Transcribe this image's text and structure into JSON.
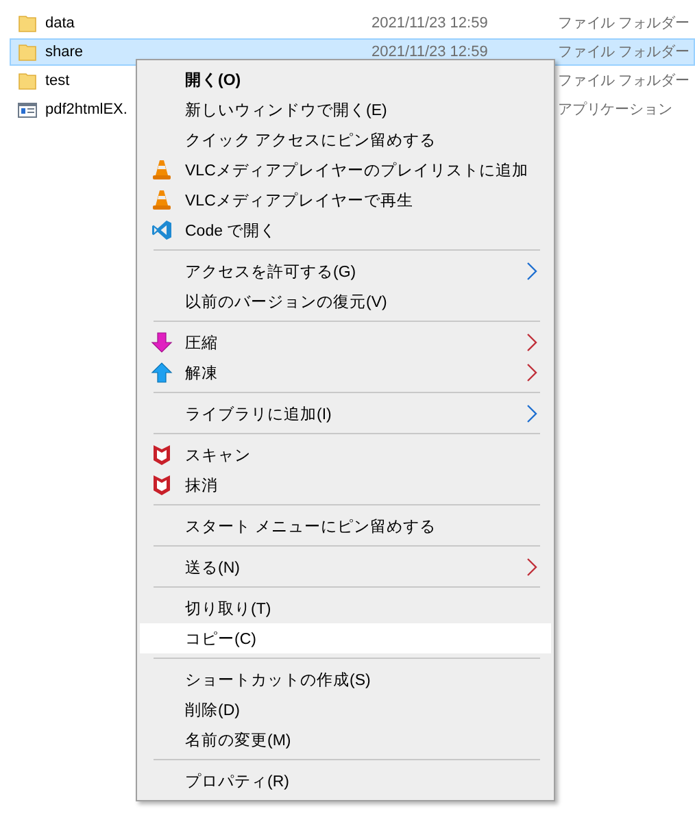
{
  "files": [
    {
      "name": "data",
      "date": "2021/11/23 12:59",
      "type": "ファイル フォルダー",
      "kind": "folder",
      "selected": false
    },
    {
      "name": "share",
      "date": "2021/11/23 12:59",
      "type": "ファイル フォルダー",
      "kind": "folder",
      "selected": true
    },
    {
      "name": "test",
      "type": "ファイル フォルダー",
      "kind": "folder",
      "selected": false
    },
    {
      "name": "pdf2htmlEX.",
      "type": "アプリケーション",
      "kind": "app",
      "selected": false
    }
  ],
  "context_menu": {
    "sections": [
      [
        {
          "label": "開く(O)",
          "bold": true,
          "selected": false
        },
        {
          "label": "新しいウィンドウで開く(E)",
          "bold": false,
          "selected": false
        },
        {
          "label": "クイック アクセスにピン留めする",
          "bold": false,
          "selected": false
        },
        {
          "label": "VLCメディアプレイヤーのプレイリストに追加",
          "bold": false,
          "selected": false
        },
        {
          "label": "VLCメディアプレイヤーで再生",
          "bold": false,
          "selected": false
        },
        {
          "label": "Code で開く",
          "bold": false,
          "selected": false
        }
      ],
      [
        {
          "label": "アクセスを許可する(G)",
          "bold": false,
          "selected": false,
          "submenu": true,
          "color": "#1e6fd0"
        },
        {
          "label": "以前のバージョンの復元(V)",
          "bold": false,
          "selected": false
        }
      ],
      [
        {
          "label": "圧縮",
          "bold": false,
          "selected": false,
          "submenu": true,
          "color": "#c0303a"
        },
        {
          "label": "解凍",
          "bold": false,
          "selected": false,
          "submenu": true,
          "color": "#c0303a"
        }
      ],
      [
        {
          "label": "ライブラリに追加(I)",
          "bold": false,
          "selected": false,
          "submenu": true,
          "color": "#1e6fd0"
        }
      ],
      [
        {
          "label": "スキャン",
          "bold": false,
          "selected": false
        },
        {
          "label": "抹消",
          "bold": false,
          "selected": false
        }
      ],
      [
        {
          "label": "スタート メニューにピン留めする",
          "bold": false,
          "selected": false
        }
      ],
      [
        {
          "label": "送る(N)",
          "bold": false,
          "selected": false,
          "submenu": true,
          "color": "#c0303a"
        }
      ],
      [
        {
          "label": "切り取り(T)",
          "bold": false,
          "selected": false
        },
        {
          "label": "コピー(C)",
          "bold": false,
          "selected": true
        }
      ],
      [
        {
          "label": "ショートカットの作成(S)",
          "bold": false,
          "selected": false
        },
        {
          "label": "削除(D)",
          "bold": false,
          "selected": false
        },
        {
          "label": "名前の変更(M)",
          "bold": false,
          "selected": false
        }
      ],
      [
        {
          "label": "プロパティ(R)",
          "bold": false,
          "selected": false
        }
      ]
    ]
  }
}
